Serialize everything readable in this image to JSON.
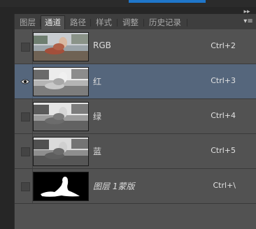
{
  "tabs": [
    {
      "label": "图层",
      "active": false
    },
    {
      "label": "通道",
      "active": true
    },
    {
      "label": "路径",
      "active": false
    },
    {
      "label": "样式",
      "active": false
    },
    {
      "label": "调整",
      "active": false
    },
    {
      "label": "历史记录",
      "active": false
    }
  ],
  "icons": {
    "collapse": "double-chevron-right-icon",
    "panel_menu": "panel-menu-icon",
    "visibility": "eye-icon"
  },
  "channels": [
    {
      "name": "RGB",
      "shortcut": "Ctrl+2",
      "visible": false,
      "selected": false,
      "thumb": "color"
    },
    {
      "name": "红",
      "shortcut": "Ctrl+3",
      "visible": true,
      "selected": true,
      "thumb": "gray"
    },
    {
      "name": "绿",
      "shortcut": "Ctrl+4",
      "visible": false,
      "selected": false,
      "thumb": "gray"
    },
    {
      "name": "蓝",
      "shortcut": "Ctrl+5",
      "visible": false,
      "selected": false,
      "thumb": "gray"
    },
    {
      "name": "图层 1蒙版",
      "shortcut": "Ctrl+\\",
      "visible": false,
      "selected": false,
      "thumb": "mask"
    }
  ],
  "colors": {
    "selected_row": "#55667c",
    "panel_bg": "#525252",
    "accent": "#1f76c9"
  }
}
